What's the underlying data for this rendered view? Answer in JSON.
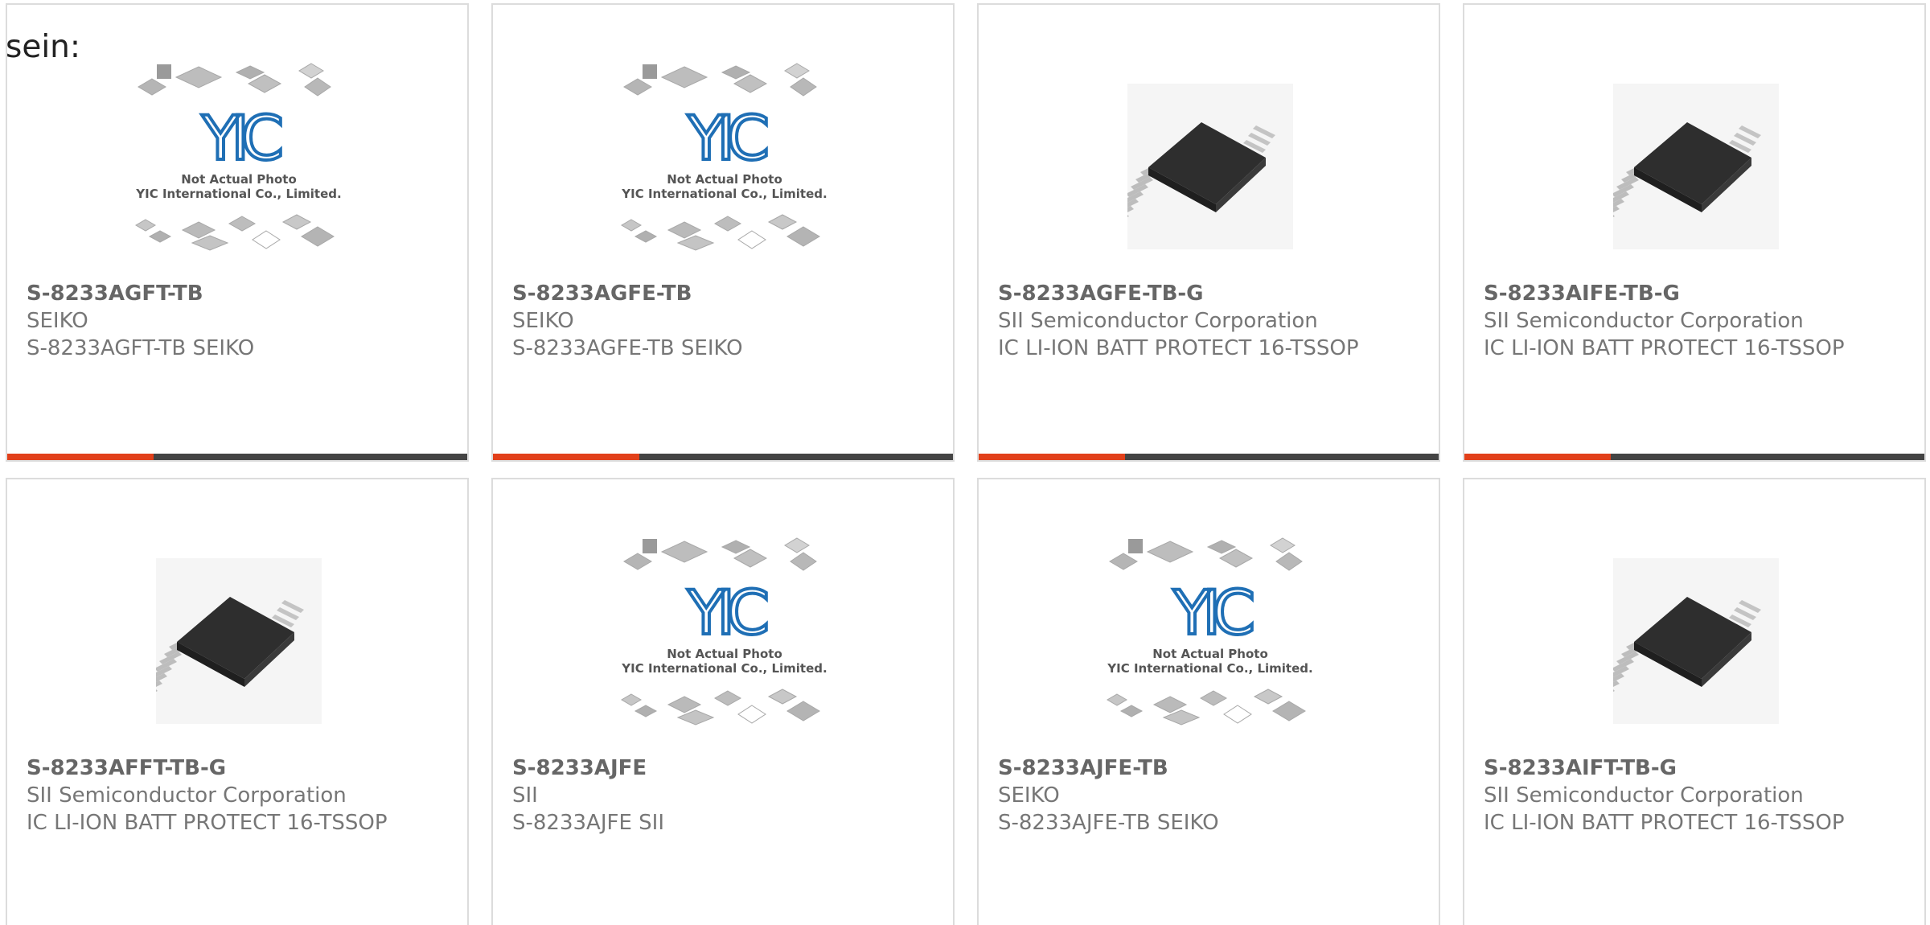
{
  "intro_text": "sein:",
  "placeholder_photo": {
    "caption_line1": "Not Actual Photo",
    "caption_line2": "YIC International Co., Limited.",
    "logo_text": "YIC"
  },
  "colors": {
    "accent": "#e2401a",
    "bar": "#444444",
    "border": "#dcdcdc",
    "text": "#767676",
    "logo_blue": "#1f6fb5"
  },
  "products": [
    {
      "part": "S-8233AGFT-TB",
      "manufacturer": "SEIKO",
      "description": "S-8233AGFT-TB SEIKO",
      "image": "placeholder-photo"
    },
    {
      "part": "S-8233AGFE-TB",
      "manufacturer": "SEIKO",
      "description": "S-8233AGFE-TB SEIKO",
      "image": "placeholder-photo"
    },
    {
      "part": "S-8233AGFE-TB-G",
      "manufacturer": "SII Semiconductor Corporation",
      "description": "IC LI-ION BATT PROTECT 16-TSSOP",
      "image": "tssop-chip"
    },
    {
      "part": "S-8233AIFE-TB-G",
      "manufacturer": "SII Semiconductor Corporation",
      "description": "IC LI-ION BATT PROTECT 16-TSSOP",
      "image": "tssop-chip"
    },
    {
      "part": "S-8233AFFT-TB-G",
      "manufacturer": "SII Semiconductor Corporation",
      "description": "IC LI-ION BATT PROTECT 16-TSSOP",
      "image": "tssop-chip"
    },
    {
      "part": "S-8233AJFE",
      "manufacturer": "SII",
      "description": "S-8233AJFE SII",
      "image": "placeholder-photo"
    },
    {
      "part": "S-8233AJFE-TB",
      "manufacturer": "SEIKO",
      "description": "S-8233AJFE-TB SEIKO",
      "image": "placeholder-photo"
    },
    {
      "part": "S-8233AIFT-TB-G",
      "manufacturer": "SII Semiconductor Corporation",
      "description": "IC LI-ION BATT PROTECT 16-TSSOP",
      "image": "tssop-chip"
    }
  ]
}
